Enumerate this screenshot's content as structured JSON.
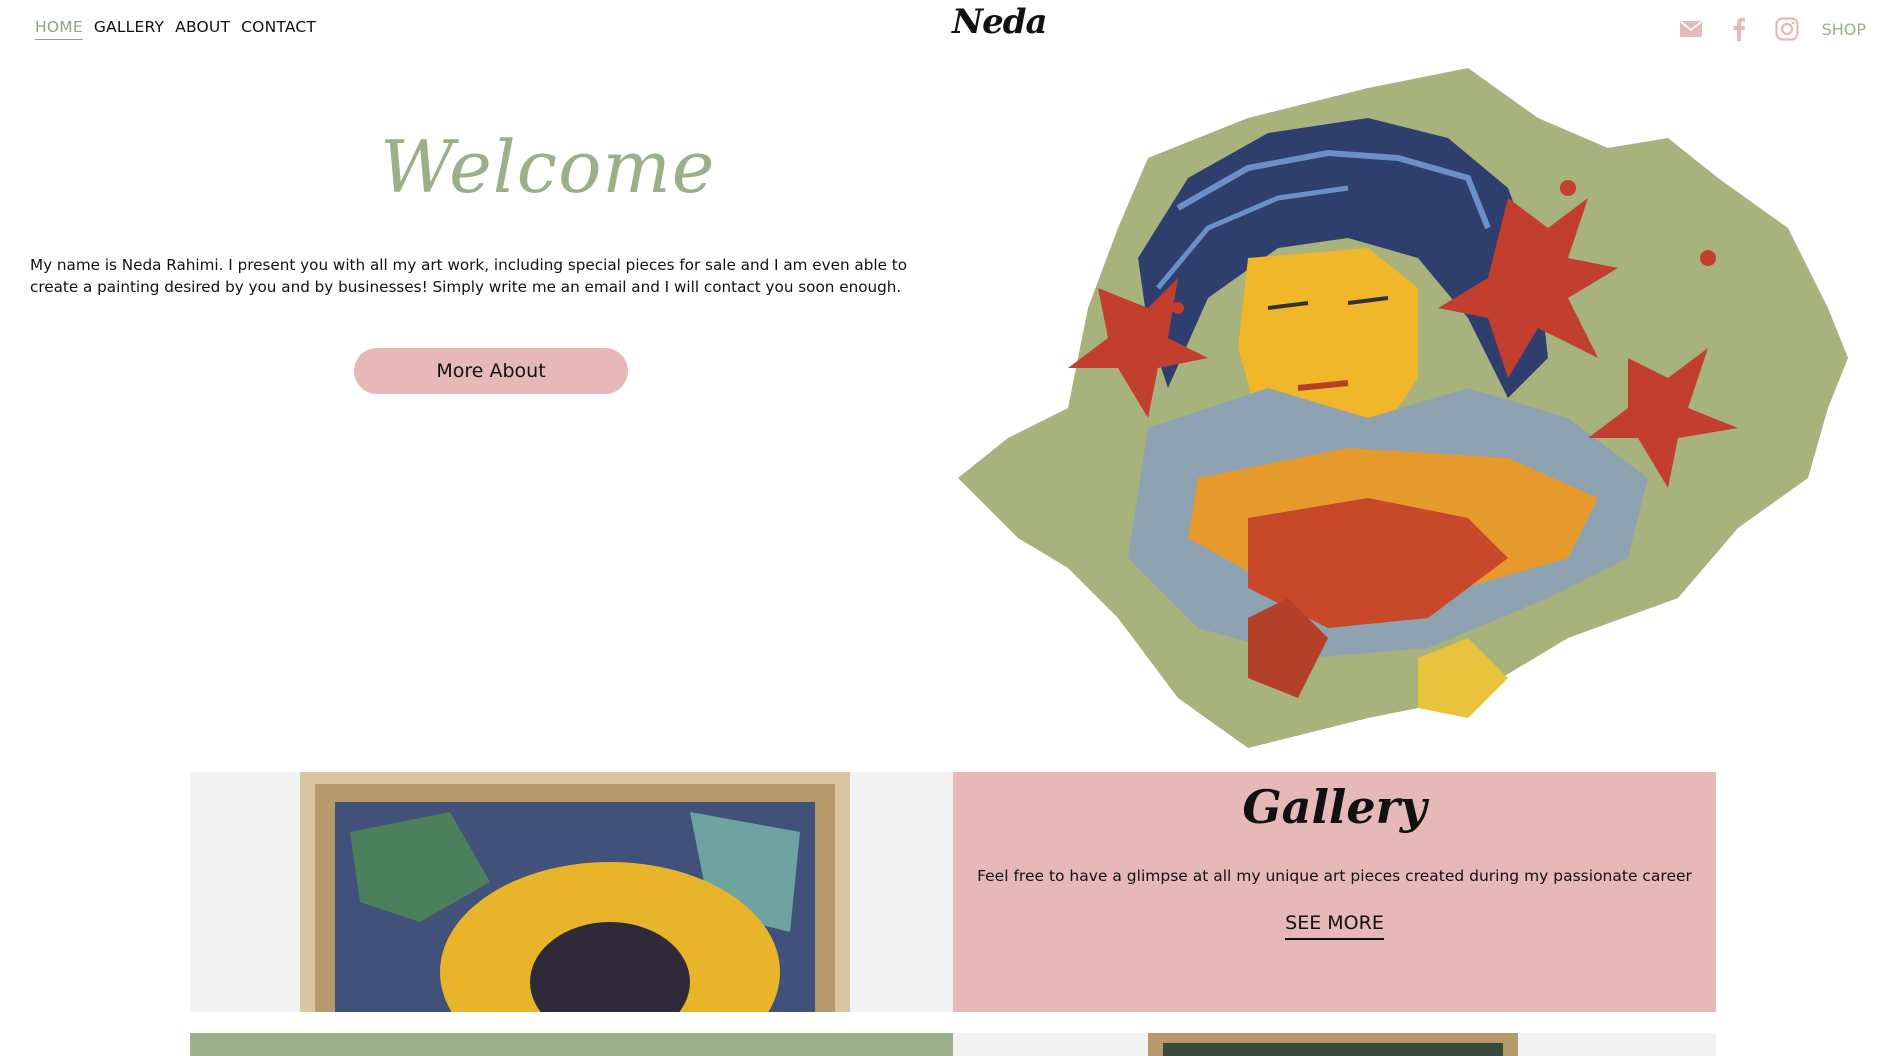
{
  "header": {
    "nav": [
      {
        "label": "HOME",
        "active": true
      },
      {
        "label": "GALLERY",
        "active": false
      },
      {
        "label": "ABOUT",
        "active": false
      },
      {
        "label": "CONTACT",
        "active": false
      }
    ],
    "logo": "Neda",
    "social_icons": [
      "mail-icon",
      "facebook-icon",
      "instagram-icon"
    ],
    "shop_label": "SHOP"
  },
  "hero": {
    "title": "Welcome",
    "intro": "My name is Neda Rahimi. I present you with all my art work, including special pieces for sale and I am even able to create a painting desired by you and by businesses! Simply write me an email and I will contact you soon enough.",
    "button_label": "More About"
  },
  "gallery": {
    "title": "Gallery",
    "text": "Feel free to have a glimpse at all my unique art pieces created during my passionate career",
    "link_label": "SEE MORE"
  },
  "colors": {
    "accent_green": "#9bb089",
    "accent_pink": "#e7b8b8",
    "text": "#111111"
  }
}
